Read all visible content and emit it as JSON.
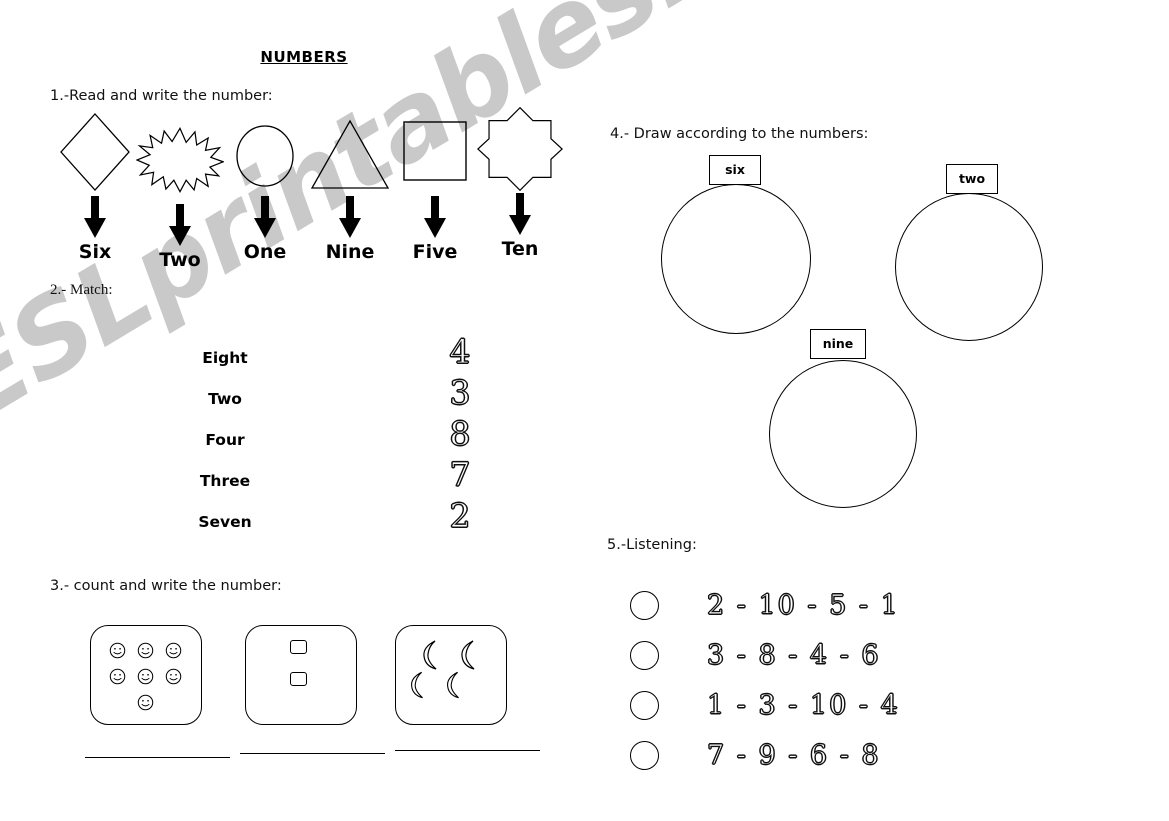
{
  "worksheet": {
    "title": "NUMBERS",
    "watermark": "ESLprintables.com"
  },
  "section1": {
    "heading": "1.-Read and write the number:",
    "items": [
      {
        "shape": "diamond-shape",
        "label": "Six"
      },
      {
        "shape": "starburst-shape",
        "label": "Two"
      },
      {
        "shape": "circle-shape",
        "label": "One"
      },
      {
        "shape": "triangle-shape",
        "label": "Nine"
      },
      {
        "shape": "square-shape",
        "label": "Five"
      },
      {
        "shape": "eight-point-star-shape",
        "label": "Ten"
      }
    ]
  },
  "section2": {
    "heading": "2.- Match:",
    "words": [
      "Eight",
      "Two",
      "Four",
      "Three",
      "Seven"
    ],
    "numbers": [
      "4",
      "3",
      "8",
      "7",
      "2"
    ]
  },
  "section3": {
    "heading": "3.- count and write the number:",
    "boxes": [
      {
        "icon": "smiley-face-icon",
        "count": 7
      },
      {
        "icon": "small-square-icon",
        "count": 2
      },
      {
        "icon": "crescent-moon-icon",
        "count": 4
      }
    ]
  },
  "section4": {
    "heading": "4.- Draw according to the numbers:",
    "circles": [
      {
        "label": "six"
      },
      {
        "label": "two"
      },
      {
        "label": "nine"
      }
    ]
  },
  "section5": {
    "heading": "5.-Listening:",
    "rows": [
      "2  -  10  -  5  -  1",
      "3  -  8  -  4  -  6",
      "1  -  3  -  10  -  4",
      "7  -  9  -  6  -  8"
    ]
  }
}
